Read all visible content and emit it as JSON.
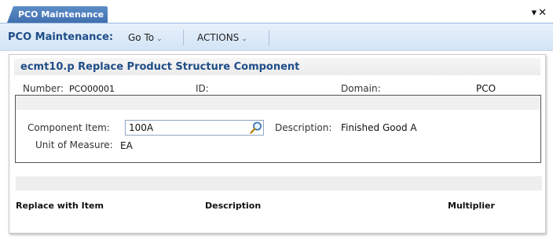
{
  "tab": {
    "label": "PCO Maintenance",
    "dropdown_icon": "caret-down-icon",
    "close_icon": "close-icon"
  },
  "toolbar": {
    "title": "PCO Maintenance:",
    "goto_label": "Go To",
    "actions_label": "ACTIONS"
  },
  "panel": {
    "heading": "ecmt10.p  Replace Product Structure Component",
    "number_label": "Number:",
    "number_value": "PCO00001",
    "id_label": "ID:",
    "id_value": "",
    "domain_label": "Domain:",
    "domain_value": "PCO",
    "component_item_label": "Component Item:",
    "component_item_value": "100A",
    "description_label": "Description:",
    "description_value": "Finished Good A",
    "uom_label": "Unit of Measure:",
    "uom_value": "EA"
  },
  "grid": {
    "columns": [
      "Replace with Item",
      "Description",
      "Multiplier"
    ]
  },
  "colors": {
    "accent": "#1f4d87",
    "tab": "#4a7bbd",
    "toolbar": "#dce9f8"
  }
}
